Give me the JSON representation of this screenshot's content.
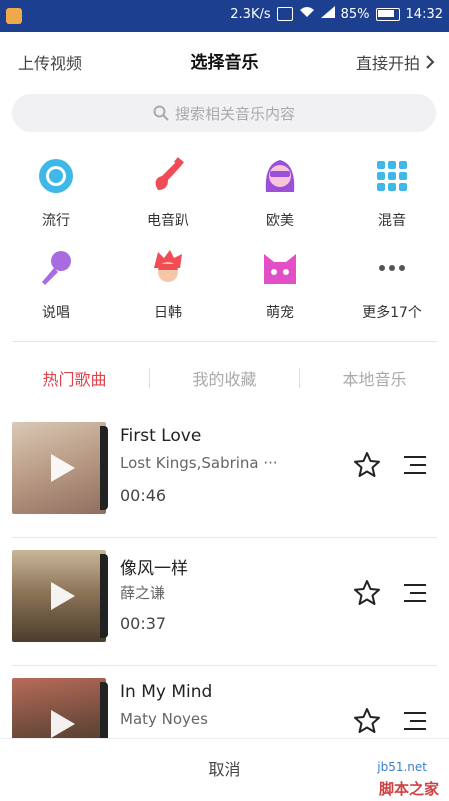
{
  "status": {
    "speed": "2.3K/s",
    "battery": "85%",
    "time": "14:32"
  },
  "header": {
    "upload": "上传视频",
    "title": "选择音乐",
    "direct": "直接开拍"
  },
  "search": {
    "placeholder": "搜索相关音乐内容"
  },
  "categories": [
    {
      "label": "流行",
      "icon": "disc-icon"
    },
    {
      "label": "电音趴",
      "icon": "guitar-icon"
    },
    {
      "label": "欧美",
      "icon": "girl-icon"
    },
    {
      "label": "混音",
      "icon": "grid-icon"
    },
    {
      "label": "说唱",
      "icon": "microphone-icon"
    },
    {
      "label": "日韩",
      "icon": "anime-boy-icon"
    },
    {
      "label": "萌宠",
      "icon": "cat-icon"
    },
    {
      "label": "更多17个",
      "icon": "more-icon"
    }
  ],
  "tabs": [
    "热门歌曲",
    "我的收藏",
    "本地音乐"
  ],
  "songs": [
    {
      "title": "First Love",
      "artist": "Lost Kings,Sabrina ···",
      "duration": "00:46"
    },
    {
      "title": "像风一样",
      "artist": "薛之谦",
      "duration": "00:37"
    },
    {
      "title": "In My Mind",
      "artist": "Maty Noyes",
      "duration": ""
    }
  ],
  "cancel": "取消",
  "watermark": {
    "url": "jb51.net",
    "name": "脚本之家"
  },
  "colors": {
    "statusbar": "#1d3f8f",
    "accent": "#e0424b"
  }
}
